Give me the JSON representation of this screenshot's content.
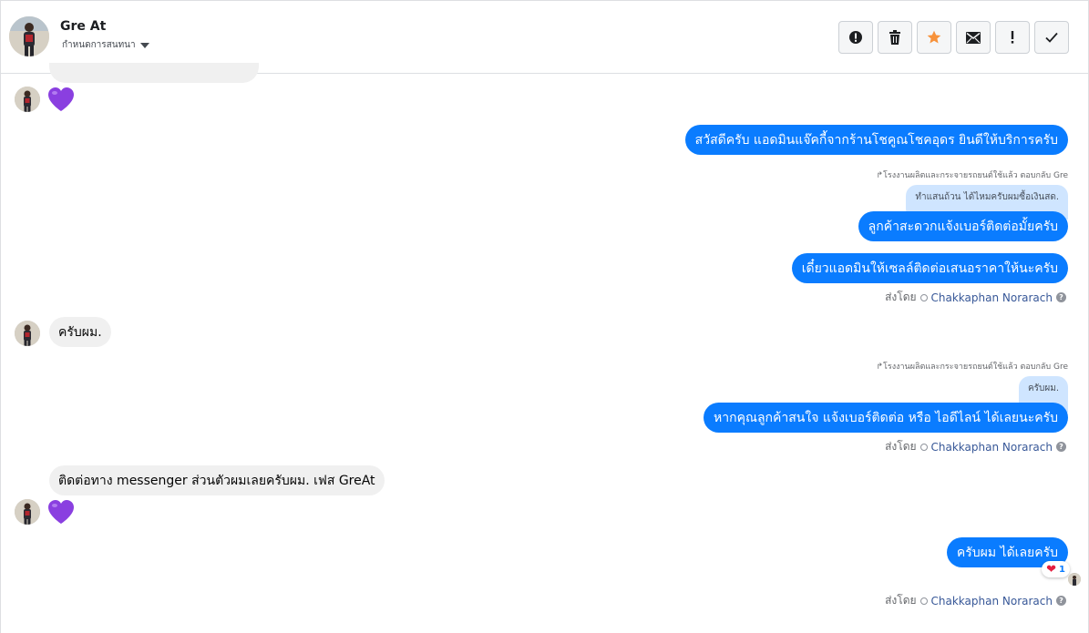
{
  "header": {
    "contact_name": "Gre At",
    "conversation_action": "กำหนดการสนทนา",
    "tools": [
      {
        "icon": "alert-circle-icon"
      },
      {
        "icon": "trash-icon"
      },
      {
        "icon": "star-icon"
      },
      {
        "icon": "mail-icon"
      },
      {
        "icon": "exclamation-icon"
      },
      {
        "icon": "check-icon"
      }
    ]
  },
  "messages": {
    "m1": "สวัสดีครับ แอดมินแจ๊คกี้จากร้านโชคูณโชคอุดร ยินดีให้บริการครับ",
    "reply1_meta": "โรงงานผลิตและกระจายรถยนต์ใช้แล้ว ตอบกลับ Gre",
    "reply1_quote": "ทำแสนถ้วน ได้ไหมครับผมซื้อเงินสด.",
    "m2": "ลูกค้าสะดวกแจ้งเบอร์ติดต่อมั้ยครับ",
    "m3": "เดี๋ยวแอดมินให้เซลล์ติดต่อเสนอราคาให้นะครับ",
    "in1": "ครับผม.",
    "reply2_meta": "โรงงานผลิตและกระจายรถยนต์ใช้แล้ว ตอบกลับ Gre",
    "reply2_quote": "ครับผม.",
    "m4": "หากคุณลูกค้าสนใจ แจ้งเบอร์ติดต่อ หรือ ไอดีไลน์ ได้เลยนะครับ",
    "in2": "ติดต่อทาง messenger ส่วนตัวผมเลยครับผม. เฟส GreAt",
    "m5": "ครับผม ได้เลยครับ",
    "reaction_count": "1"
  },
  "sent_by": {
    "label": "ส่งโดย",
    "name": "Chakkaphan Norarach",
    "help": "?"
  },
  "colors": {
    "outgoing_bubble": "#0a7cff",
    "incoming_bubble": "#f0f0f0",
    "heart": "#8a3fe0",
    "star": "#f7923b"
  }
}
